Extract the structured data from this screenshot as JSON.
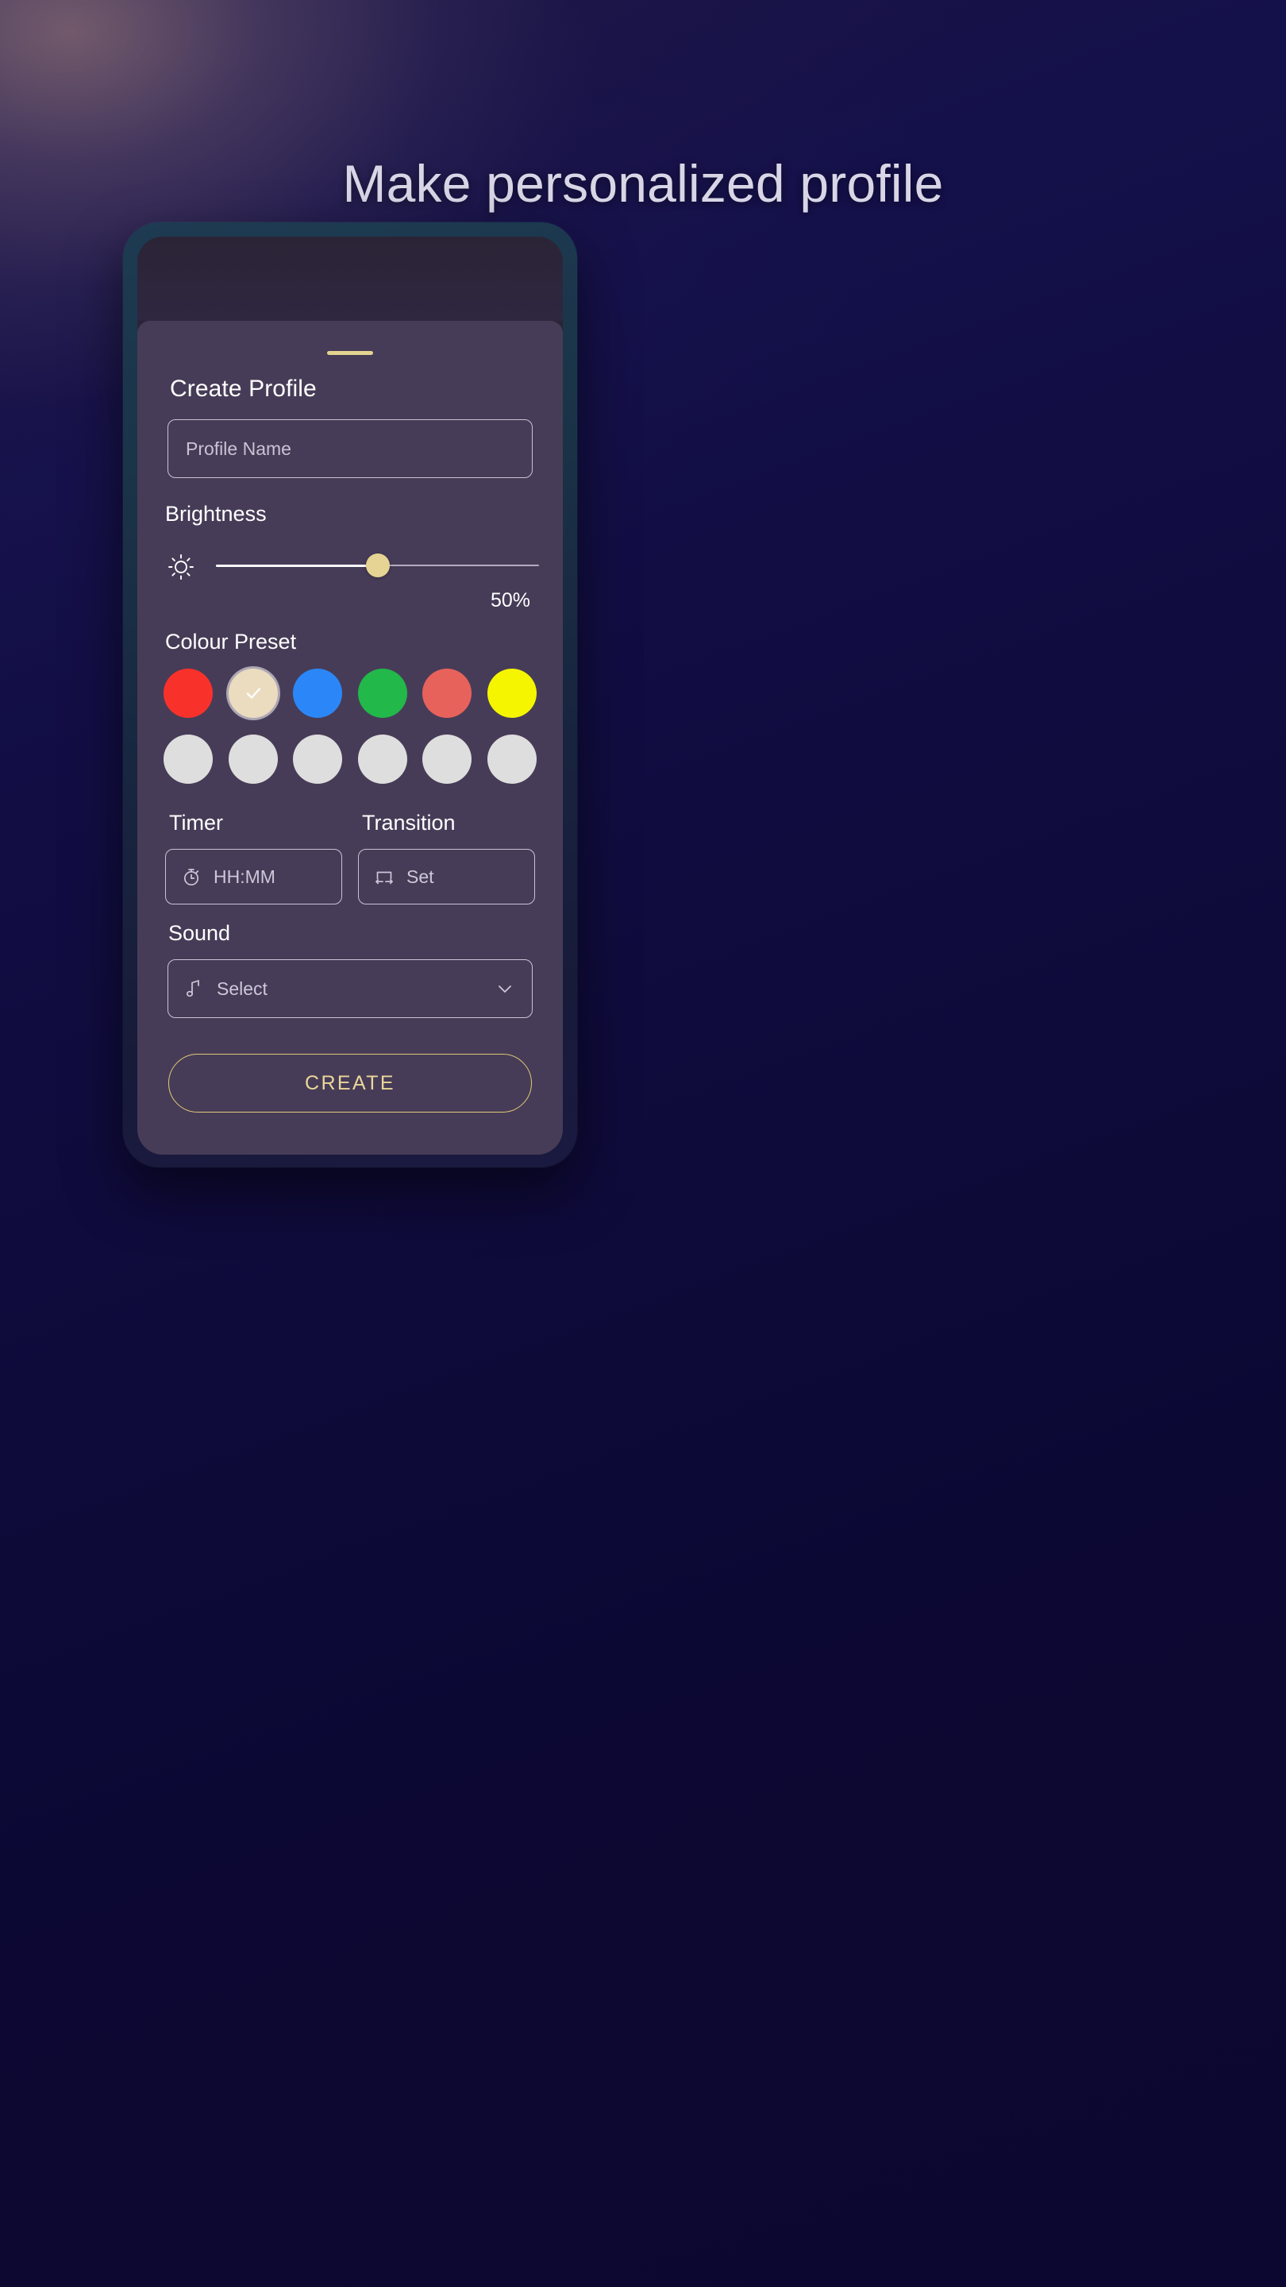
{
  "headline": "Make personalized profile",
  "colors": {
    "background_deep": "#0d0a33",
    "phone_bezel": "#1d3b52",
    "sheet_bg": "#473c57",
    "accent_gold": "#e3d58f",
    "create_border": "#e0c978",
    "create_text": "#ead79a",
    "slider_thumb": "#e5d493",
    "field_border": "#c9c2d4"
  },
  "sheet": {
    "drag_handle": "drag-handle",
    "title": "Create Profile",
    "profile_name": {
      "label": "Profile Name",
      "placeholder": "Profile Name",
      "value": ""
    },
    "brightness": {
      "label": "Brightness",
      "icon": "sun-icon",
      "value_text": "50%",
      "value": 50,
      "min": 0,
      "max": 100
    },
    "colour_preset": {
      "label": "Colour Preset",
      "row1": [
        {
          "name": "red",
          "hex": "#f8322b",
          "selected": false
        },
        {
          "name": "cream",
          "hex": "#ebdcc0",
          "selected": true
        },
        {
          "name": "blue",
          "hex": "#2b87f7",
          "selected": false
        },
        {
          "name": "green",
          "hex": "#22b84a",
          "selected": false
        },
        {
          "name": "salmon",
          "hex": "#e8625c",
          "selected": false
        },
        {
          "name": "yellow",
          "hex": "#f5f500",
          "selected": false
        }
      ],
      "row2": [
        {
          "name": "empty-1",
          "hex": "#dedede",
          "selected": false
        },
        {
          "name": "empty-2",
          "hex": "#dedede",
          "selected": false
        },
        {
          "name": "empty-3",
          "hex": "#dedede",
          "selected": false
        },
        {
          "name": "empty-4",
          "hex": "#dedede",
          "selected": false
        },
        {
          "name": "empty-5",
          "hex": "#dedede",
          "selected": false
        },
        {
          "name": "empty-6",
          "hex": "#dedede",
          "selected": false
        }
      ]
    },
    "timer": {
      "label": "Timer",
      "icon": "stopwatch-icon",
      "value": "HH:MM"
    },
    "transition": {
      "label": "Transition",
      "icon": "transition-icon",
      "value": "Set"
    },
    "sound": {
      "label": "Sound",
      "icon": "music-note-icon",
      "value": "Select",
      "chevron": "chevron-down-icon"
    },
    "create_button": "CREATE"
  }
}
